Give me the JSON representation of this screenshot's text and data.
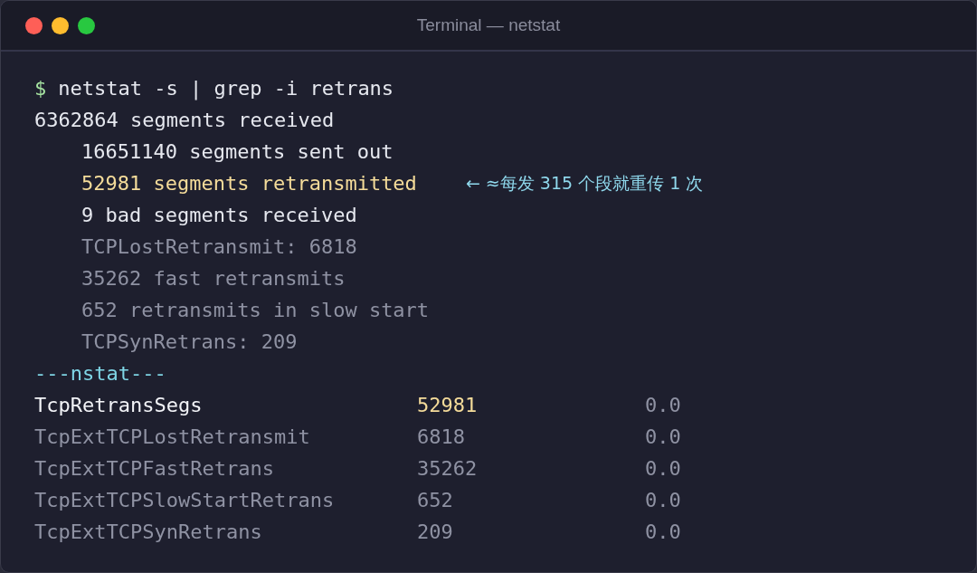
{
  "window": {
    "title": "Terminal — netstat"
  },
  "command": {
    "prompt": "$",
    "text": "netstat -s | grep -i retrans"
  },
  "output": [
    {
      "text": "6362864 segments received",
      "kind": "normal",
      "children": [
        {
          "text": "16651140 segments sent out",
          "kind": "normal"
        },
        {
          "text": "52981 segments retransmitted",
          "kind": "highlight",
          "note": "← ≈每发 315 个段就重传 1 次"
        },
        {
          "text": "9 bad segments received",
          "kind": "normal"
        },
        {
          "text": "TCPLostRetransmit: 6818",
          "kind": "dim"
        },
        {
          "text": "35262 fast retransmits",
          "kind": "dim"
        },
        {
          "text": "652 retransmits in slow start",
          "kind": "dim"
        },
        {
          "text": "TCPSynRetrans: 209",
          "kind": "dim"
        }
      ]
    }
  ],
  "section": "---nstat---",
  "nstat_rows": [
    {
      "name": "TcpRetransSegs",
      "value": "52981",
      "rate": "0.0",
      "highlight": true
    },
    {
      "name": "TcpExtTCPLostRetransmit",
      "value": "6818",
      "rate": "0.0",
      "highlight": false
    },
    {
      "name": "TcpExtTCPFastRetrans",
      "value": "35262",
      "rate": "0.0",
      "highlight": false
    },
    {
      "name": "TcpExtTCPSlowStartRetrans",
      "value": "652",
      "rate": "0.0",
      "highlight": false
    },
    {
      "name": "TcpExtTCPSynRetrans",
      "value": "209",
      "rate": "0.0",
      "highlight": false
    }
  ]
}
